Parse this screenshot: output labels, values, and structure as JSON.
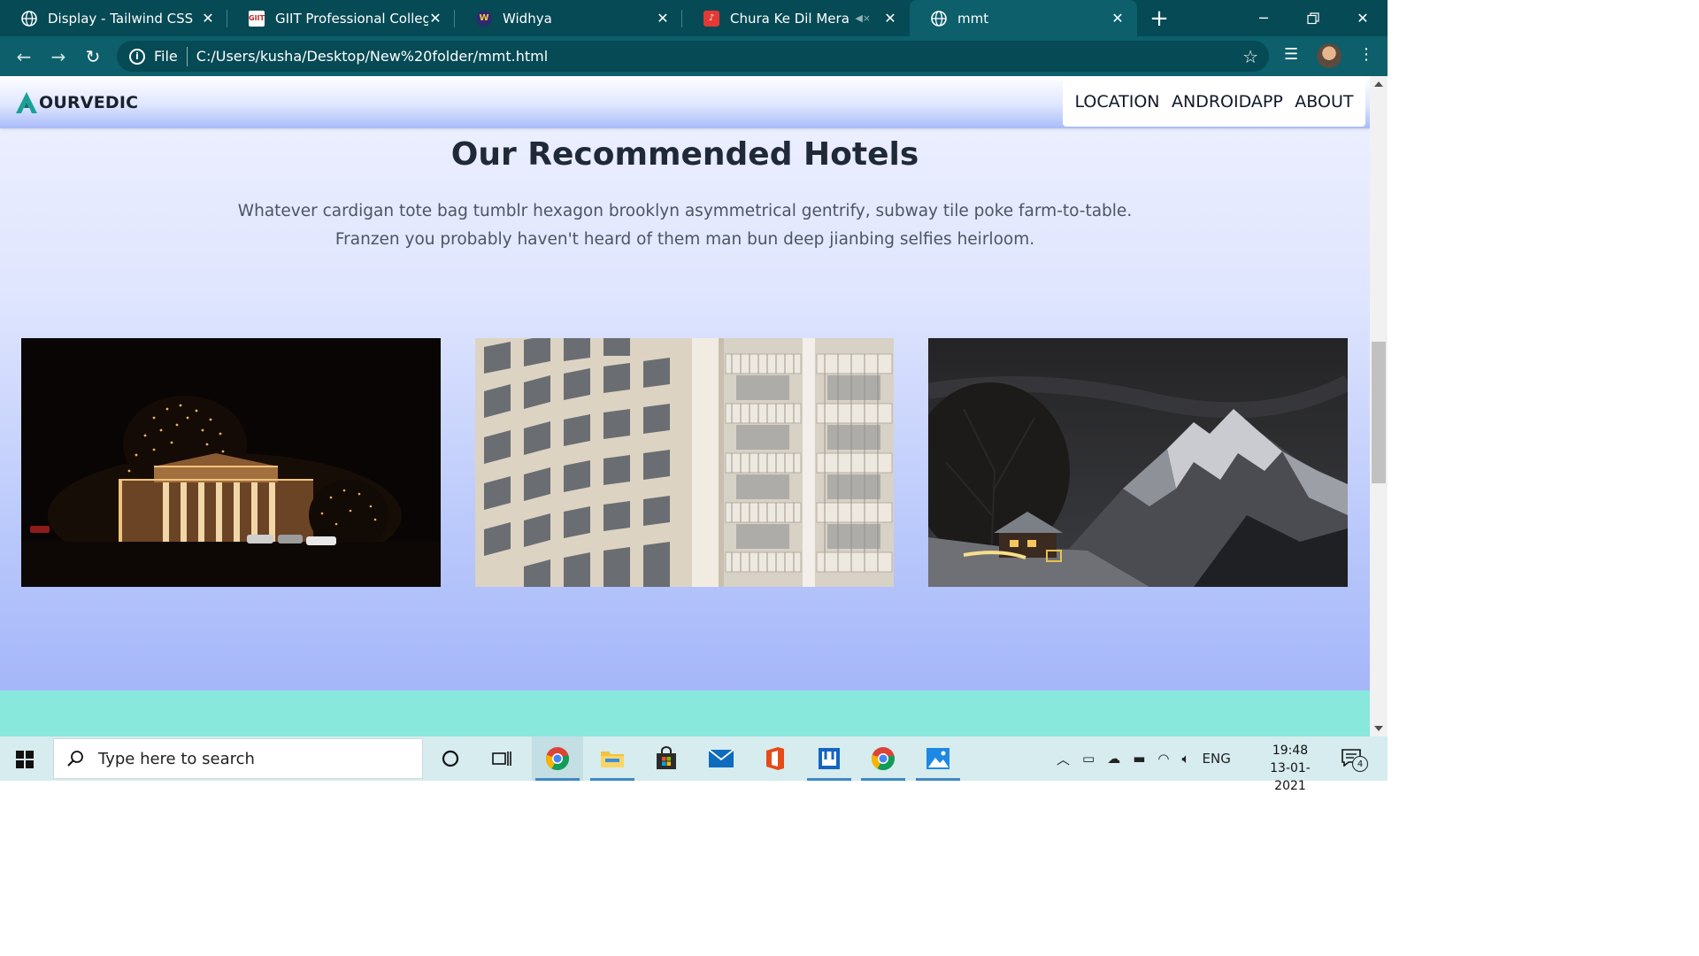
{
  "browser": {
    "tabs": [
      {
        "title": "Display - Tailwind CSS",
        "favicon": "globe-icon",
        "active": false
      },
      {
        "title": "GIIT Professional College",
        "favicon": "college-logo-icon",
        "active": false
      },
      {
        "title": "Widhya",
        "favicon": "widhya-logo-icon",
        "active": false
      },
      {
        "title": "Chura Ke Dil Mera",
        "favicon": "music-icon",
        "active": false,
        "muted": true
      },
      {
        "title": "mmt",
        "favicon": "globe-icon",
        "active": true
      }
    ],
    "address": {
      "scheme_label": "File",
      "url": "C:/Users/kusha/Desktop/New%20folder/mmt.html"
    },
    "theme_color": "#054a55"
  },
  "site": {
    "brand": "OURVEDIC",
    "nav": [
      "LOCATION",
      "ANDROIDAPP",
      "ABOUT"
    ],
    "section": {
      "title": "Our Recommended Hotels",
      "description_lines": [
        "Whatever cardigan tote bag tumblr hexagon brooklyn asymmetrical gentrify, subway tile poke farm-to-table.",
        "Franzen you probably haven't heard of them man bun deep jianbing selfies heirloom."
      ]
    },
    "hotels": [
      {
        "image": "illuminated-palace-night"
      },
      {
        "image": "hotel-facade-balconies"
      },
      {
        "image": "mountain-cabin-night"
      }
    ],
    "accent_color": "#88e8dc"
  },
  "taskbar": {
    "search_placeholder": "Type here to search",
    "apps": [
      "cortana-icon",
      "task-view-icon",
      "chrome-icon",
      "file-explorer-icon",
      "store-icon",
      "mail-icon",
      "office-icon",
      "terminal-icon",
      "chrome-icon",
      "photos-icon"
    ],
    "tray": {
      "language": "ENG",
      "time": "19:48",
      "date": "13-01-2021",
      "notification_count": "4"
    }
  }
}
